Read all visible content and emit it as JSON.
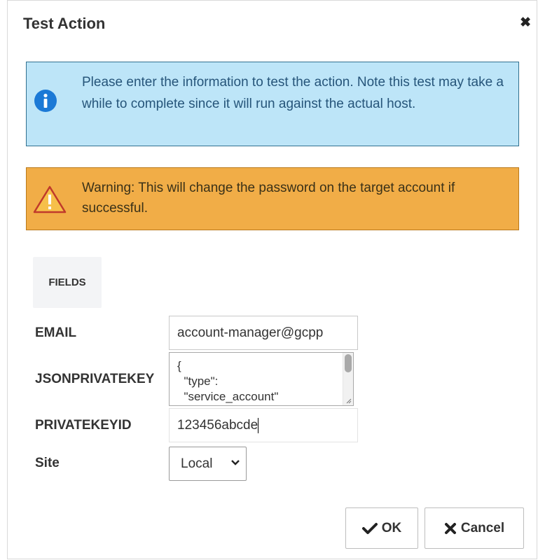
{
  "dialog": {
    "title": "Test Action",
    "close_symbol": "✖"
  },
  "info_alert": {
    "icon": "info-icon",
    "text": "Please enter the information to test the action. Note this test may take a while to complete since it will run against the actual host."
  },
  "warning_alert": {
    "icon": "warning-icon",
    "text": "Warning: This will change the password on the target account if successful."
  },
  "fields_tab": {
    "label": "FIELDS"
  },
  "fields": {
    "email": {
      "label": "EMAIL",
      "value": "account-manager@gcpp"
    },
    "json_private_key": {
      "label": "JSONPRIVATEKEY",
      "value": "{\n  \"type\":\n  \"service_account\""
    },
    "private_key_id": {
      "label": "PRIVATEKEYID",
      "value": "123456abcde"
    },
    "site": {
      "label": "Site",
      "selected": "Local"
    }
  },
  "buttons": {
    "ok_label": "OK",
    "cancel_label": "Cancel"
  },
  "colors": {
    "info_bg": "#bde5f8",
    "info_border": "#31708f",
    "info_icon": "#1b79d6",
    "warning_bg": "#f1ad47",
    "warning_border": "#b9791c"
  }
}
